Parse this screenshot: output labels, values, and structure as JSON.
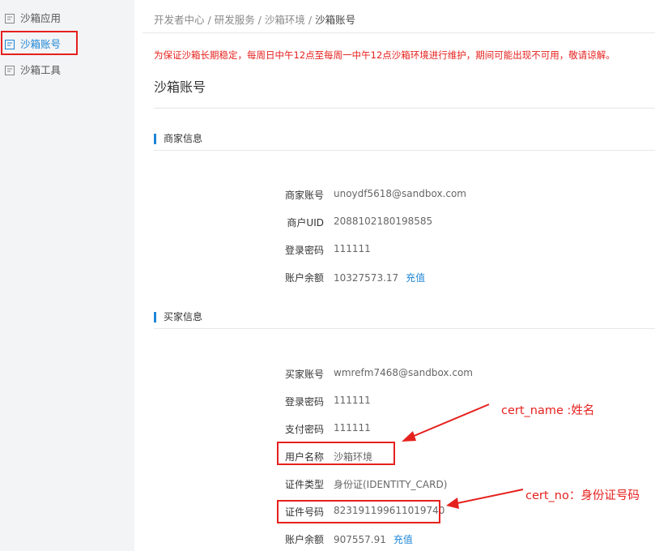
{
  "sidebar": {
    "items": [
      {
        "label": "沙箱应用",
        "icon": "app-icon"
      },
      {
        "label": "沙箱账号",
        "icon": "account-icon"
      },
      {
        "label": "沙箱工具",
        "icon": "tool-icon"
      }
    ]
  },
  "breadcrumb": {
    "items": [
      "开发者中心",
      "研发服务",
      "沙箱环境"
    ],
    "separator": " / ",
    "current": "沙箱账号"
  },
  "notice": "为保证沙箱长期稳定，每周日中午12点至每周一中午12点沙箱环境进行维护，期间可能出现不可用，敬请谅解。",
  "page_title": "沙箱账号",
  "merchant": {
    "title": "商家信息",
    "rows": [
      {
        "label": "商家账号",
        "value": "unoydf5618@sandbox.com"
      },
      {
        "label": "商户UID",
        "value": "2088102180198585"
      },
      {
        "label": "登录密码",
        "value": "111111"
      },
      {
        "label": "账户余额",
        "value": "10327573.17",
        "link": "充值"
      }
    ]
  },
  "buyer": {
    "title": "买家信息",
    "rows": [
      {
        "label": "买家账号",
        "value": "wmrefm7468@sandbox.com"
      },
      {
        "label": "登录密码",
        "value": "111111"
      },
      {
        "label": "支付密码",
        "value": "111111"
      },
      {
        "label": "用户名称",
        "value": "沙箱环境"
      },
      {
        "label": "证件类型",
        "value": "身份证(IDENTITY_CARD)"
      },
      {
        "label": "证件号码",
        "value": "823191199611019740"
      },
      {
        "label": "账户余额",
        "value": "907557.91",
        "link": "充值"
      }
    ]
  },
  "annotations": {
    "cert_name": "cert_name :姓名",
    "cert_no": "cert_no：身份证号码"
  },
  "colors": {
    "accent": "#1e86d6",
    "highlight": "#e5211e",
    "sidebar_bg": "#f3f4f6"
  }
}
